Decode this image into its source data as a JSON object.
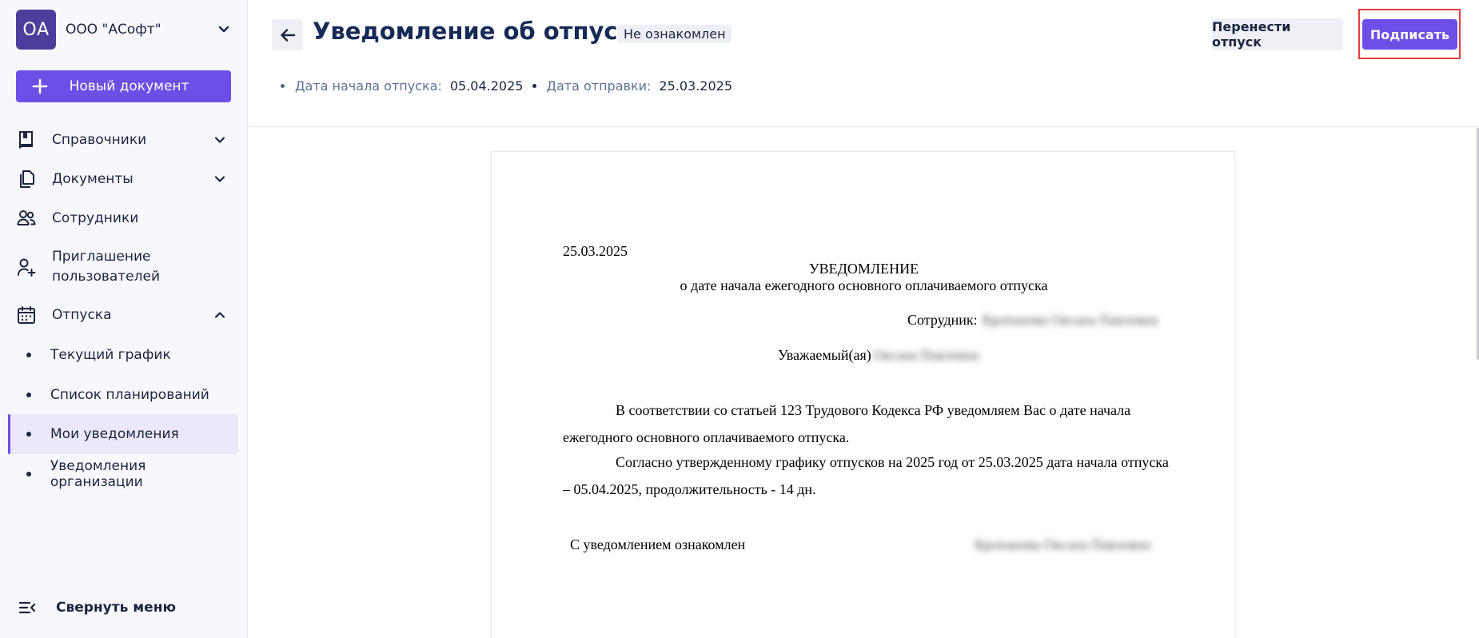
{
  "org": {
    "initials": "ОА",
    "name": "ООО \"АСофт\""
  },
  "sidebar": {
    "new_document_label": "Новый документ",
    "items": [
      {
        "label": "Справочники",
        "icon": "book-icon",
        "has_chevron": true,
        "expanded": false
      },
      {
        "label": "Документы",
        "icon": "documents-icon",
        "has_chevron": true,
        "expanded": false
      },
      {
        "label": "Сотрудники",
        "icon": "users-icon",
        "has_chevron": false
      },
      {
        "label": "Приглашение пользователей",
        "icon": "user-plus-icon",
        "has_chevron": false
      },
      {
        "label": "Отпуска",
        "icon": "calendar-icon",
        "has_chevron": true,
        "expanded": true
      }
    ],
    "subitems": [
      {
        "label": "Текущий график",
        "active": false
      },
      {
        "label": "Список планирований",
        "active": false
      },
      {
        "label": "Мои уведомления",
        "active": true
      },
      {
        "label": "Уведомления организации",
        "active": false
      }
    ],
    "collapse_label": "Свернуть меню"
  },
  "header": {
    "title": "Уведомление об отпуске",
    "status": "Не ознакомлен",
    "meta": {
      "start_label": "Дата начала отпуска:",
      "start_value": "05.04.2025",
      "sent_label": "Дата отправки:",
      "sent_value": "25.03.2025"
    },
    "move_button": "Перенести отпуск",
    "sign_button": "Подписать"
  },
  "document": {
    "date": "25.03.2025",
    "title": "УВЕДОМЛЕНИЕ",
    "subtitle": "о дате начала ежегодного основного оплачиваемого отпуска",
    "employee_label": "Сотрудник:",
    "employee_name_redacted": "Кропанова Оксана Павловна",
    "greeting": "Уважаемый(ая)",
    "greeting_name_redacted": "Оксана Павловна",
    "paragraph1": "В соответствии со статьей 123 Трудового Кодекса РФ уведомляем Вас о дате начала ежегодного основного оплачиваемого отпуска.",
    "paragraph2": "Согласно утвержденному графику отпусков на 2025 год от 25.03.2025 дата начала отпуска – 05.04.2025, продолжительность - 14 дн.",
    "acknowledged": "С уведомлением ознакомлен",
    "signature_name_redacted": "Кропанова Оксана Павловна"
  },
  "colors": {
    "accent": "#6d4ee6",
    "org_avatar": "#4b3f9b",
    "highlight_border": "#e04040",
    "title": "#162a57"
  }
}
